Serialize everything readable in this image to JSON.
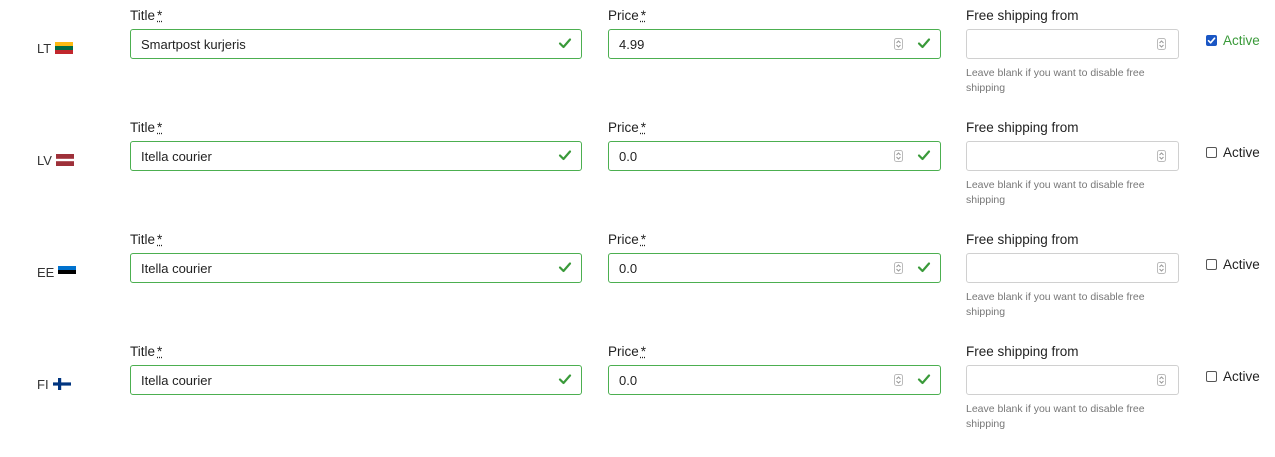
{
  "labels": {
    "title": "Title",
    "price": "Price",
    "required_mark": "*",
    "free_shipping": "Free shipping from",
    "hint": "Leave blank if you want to disable free shipping",
    "active": "Active"
  },
  "rows": [
    {
      "country": "LT",
      "flag": "lithuania-flag",
      "title_value": "Smartpost kurjeris",
      "price_value": "4.99",
      "free_shipping_value": "",
      "active": true
    },
    {
      "country": "LV",
      "flag": "latvia-flag",
      "title_value": "Itella courier",
      "price_value": "0.0",
      "free_shipping_value": "",
      "active": false
    },
    {
      "country": "EE",
      "flag": "estonia-flag",
      "title_value": "Itella courier",
      "price_value": "0.0",
      "free_shipping_value": "",
      "active": false
    },
    {
      "country": "FI",
      "flag": "finland-flag",
      "title_value": "Itella courier",
      "price_value": "0.0",
      "free_shipping_value": "",
      "active": false
    }
  ],
  "colors": {
    "valid_border": "#4caf50",
    "check": "#3a9a3a",
    "active_text": "#3a9a3a",
    "checkbox_checked": "#1a56c4"
  }
}
